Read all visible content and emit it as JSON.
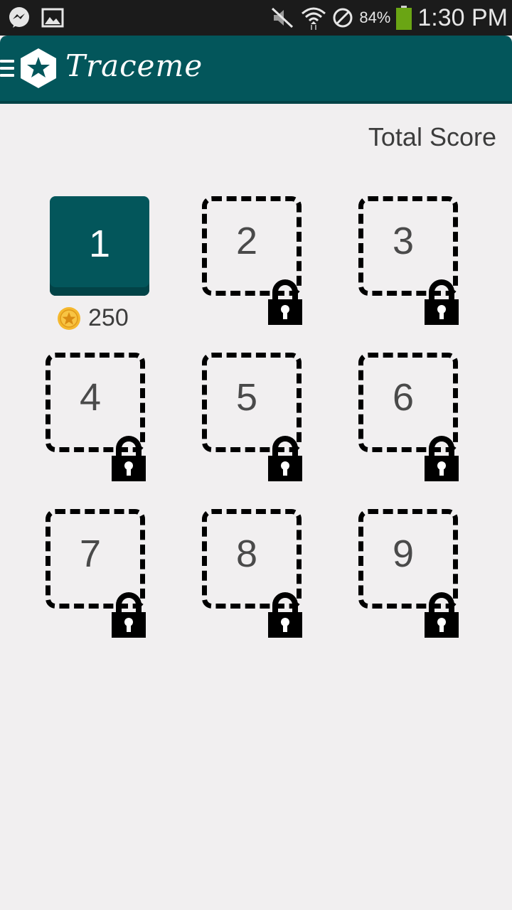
{
  "status_bar": {
    "battery_percent": "84%",
    "time": "1:30 PM",
    "left_icons": [
      "messenger-icon",
      "image-icon"
    ],
    "right_icons": [
      "mute-icon",
      "wifi-icon",
      "no-entry-icon",
      "battery-icon"
    ],
    "battery_color": "#6aa514"
  },
  "app_bar": {
    "title": "Traceme",
    "background": "#03565b"
  },
  "header": {
    "total_score_label": "Total Score"
  },
  "levels": [
    {
      "number": "1",
      "locked": false,
      "score": "250"
    },
    {
      "number": "2",
      "locked": true
    },
    {
      "number": "3",
      "locked": true
    },
    {
      "number": "4",
      "locked": true
    },
    {
      "number": "5",
      "locked": true
    },
    {
      "number": "6",
      "locked": true
    },
    {
      "number": "7",
      "locked": true
    },
    {
      "number": "8",
      "locked": true
    },
    {
      "number": "9",
      "locked": true
    }
  ]
}
